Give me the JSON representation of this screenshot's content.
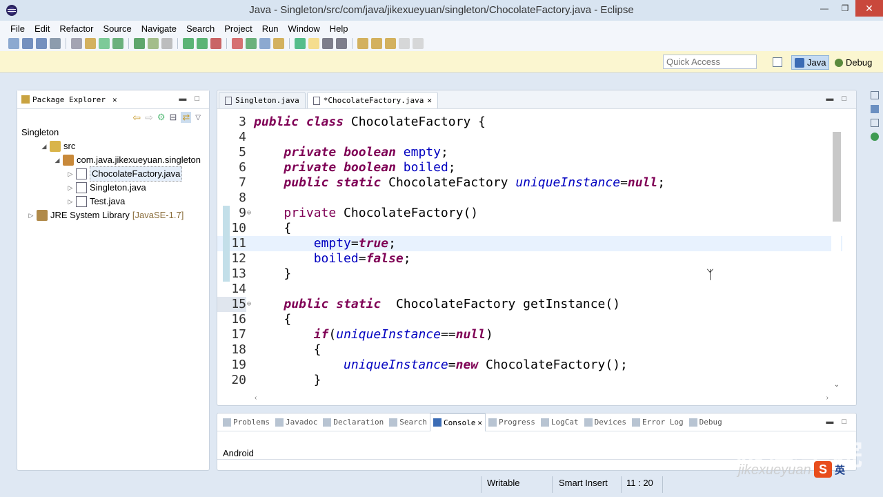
{
  "window": {
    "title": "Java - Singleton/src/com/java/jikexueyuan/singleton/ChocolateFactory.java - Eclipse"
  },
  "menu": [
    "File",
    "Edit",
    "Refactor",
    "Source",
    "Navigate",
    "Search",
    "Project",
    "Run",
    "Window",
    "Help"
  ],
  "toolbar": {
    "quick_access_placeholder": "Quick Access",
    "perspectives": [
      {
        "label": "Java",
        "active": true
      },
      {
        "label": "Debug",
        "active": false
      }
    ]
  },
  "package_explorer": {
    "tab_label": "Package Explorer",
    "project": "Singleton",
    "tree": [
      {
        "label": "src",
        "depth": 1,
        "expanded": true,
        "icon": "source-folder-icon"
      },
      {
        "label": "com.java.jikexueyuan.singleton",
        "depth": 2,
        "expanded": true,
        "icon": "package-icon"
      },
      {
        "label": "ChocolateFactory.java",
        "depth": 3,
        "icon": "java-file-icon",
        "selected": true
      },
      {
        "label": "Singleton.java",
        "depth": 3,
        "icon": "java-file-icon"
      },
      {
        "label": "Test.java",
        "depth": 3,
        "icon": "java-file-icon"
      },
      {
        "label": "JRE System Library",
        "decoration": "[JavaSE-1.7]",
        "depth": 0,
        "icon": "library-icon"
      }
    ]
  },
  "editor": {
    "tabs": [
      {
        "label": "Singleton.java",
        "active": false
      },
      {
        "label": "*ChocolateFactory.java",
        "active": true
      }
    ],
    "current_line": 11,
    "lines": [
      {
        "n": "3",
        "html": "<span class='kw'>public</span> <span class='kw'>class</span> ChocolateFactory {"
      },
      {
        "n": "4",
        "html": ""
      },
      {
        "n": "5",
        "html": "    <span class='kw'>private</span> <span class='kw'>boolean</span> <span class='fld'>empty</span>;"
      },
      {
        "n": "6",
        "html": "    <span class='kw'>private</span> <span class='kw'>boolean</span> <span class='fld'>boiled</span>;"
      },
      {
        "n": "7",
        "html": "    <span class='kw'>public</span> <span class='kw'>static</span> ChocolateFactory <span class='sfld'>uniqueInstance</span>=<span class='kw'>null</span>;"
      },
      {
        "n": "8",
        "html": ""
      },
      {
        "n": "9",
        "html": "    <span class='kwp'>private</span> ChocolateFactory()",
        "fold": true
      },
      {
        "n": "10",
        "html": "    {"
      },
      {
        "n": "11",
        "html": "        <span class='fld'>empty</span>=<span class='kw'>true</span>;"
      },
      {
        "n": "12",
        "html": "        <span class='fld'>boiled</span>=<span class='kw'>false</span>;"
      },
      {
        "n": "13",
        "html": "    }"
      },
      {
        "n": "14",
        "html": ""
      },
      {
        "n": "15",
        "html": "    <span class='kw'>public</span> <span class='kw'>static</span>  ChocolateFactory getInstance()",
        "fold": true,
        "hl": true
      },
      {
        "n": "16",
        "html": "    {"
      },
      {
        "n": "17",
        "html": "        <span class='kw'>if</span>(<span class='sfld'>uniqueInstance</span>==<span class='kw'>null</span>)"
      },
      {
        "n": "18",
        "html": "        {"
      },
      {
        "n": "19",
        "html": "            <span class='sfld'>uniqueInstance</span>=<span class='kw'>new</span> ChocolateFactory();"
      },
      {
        "n": "20",
        "html": "        }"
      }
    ]
  },
  "bottom_panel": {
    "tabs": [
      {
        "label": "Problems",
        "active": false
      },
      {
        "label": "Javadoc",
        "active": false
      },
      {
        "label": "Declaration",
        "active": false
      },
      {
        "label": "Search",
        "active": false
      },
      {
        "label": "Console",
        "active": true
      },
      {
        "label": "Progress",
        "active": false
      },
      {
        "label": "LogCat",
        "active": false
      },
      {
        "label": "Devices",
        "active": false
      },
      {
        "label": "Error Log",
        "active": false
      },
      {
        "label": "Debug",
        "active": false
      }
    ],
    "console_text": "Android"
  },
  "status": {
    "writable": "Writable",
    "insert_mode": "Smart Insert",
    "position": "11 : 20"
  },
  "watermark": {
    "cn": "极客学院",
    "en": "jikexueyuan"
  },
  "ime": {
    "s": "S",
    "lang": "英"
  }
}
